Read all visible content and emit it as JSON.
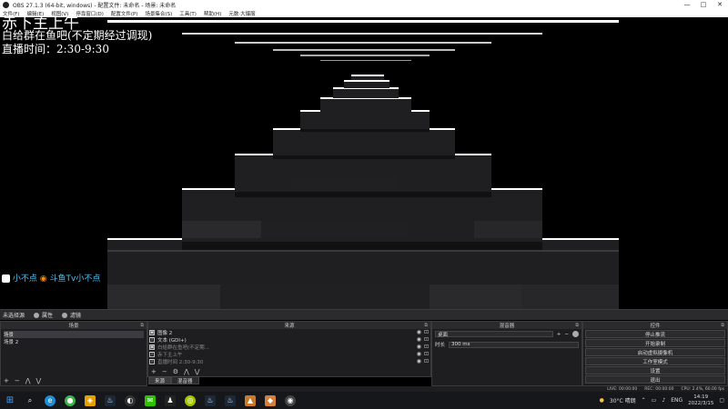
{
  "window": {
    "title": "OBS 27.1.3 (64-bit, windows) - 配置文件: 未命名 - 场景: 未命名",
    "controls": [
      "—",
      "□",
      "✕"
    ]
  },
  "menu": [
    "文件(F)",
    "编辑(E)",
    "视图(V)",
    "停靠窗口(D)",
    "配置文件(P)",
    "场景集合(S)",
    "工具(T)",
    "帮助(H)",
    "元数·大爆服"
  ],
  "overlay": {
    "line1": "赤下主上午",
    "line2": "白给群在鱼吧(不定期经过调现)",
    "line3": "直播时间：2:30-9:30"
  },
  "watermark": {
    "small": "小不点",
    "tv": "斗鱼Tv小不点"
  },
  "scene_bar": {
    "label": "未选择源",
    "props": "属性",
    "filters": "滤镜"
  },
  "scenes": {
    "title": "场景",
    "items": [
      "场景",
      "场景 2"
    ],
    "selected": 0
  },
  "sources": {
    "title": "来源",
    "items": [
      {
        "icon": "image-icon",
        "label": "图像 2"
      },
      {
        "icon": "text-icon",
        "label": "文本 (GDI+)"
      },
      {
        "icon": "image-icon",
        "label": "白给群在鱼吧(不定期..."
      },
      {
        "icon": "text-icon",
        "label": "赤下主上午"
      },
      {
        "icon": "text-icon",
        "label": "直播时间 2:30-9:30"
      }
    ],
    "tabs": [
      "来源",
      "混音器"
    ]
  },
  "mixer": {
    "title": "混音器",
    "rows": [
      {
        "label": "",
        "value": "桌面"
      },
      {
        "label": "时长",
        "value": "300 ms"
      }
    ]
  },
  "controls": {
    "title": "控件",
    "buttons": [
      "停止推流",
      "开始录制",
      "启动虚拟摄像机",
      "工作室模式",
      "设置",
      "退出"
    ]
  },
  "status": {
    "live": "LIVE: 00:00:00",
    "rec": "REC: 00:00:00",
    "cpu": "CPU: 2.4%, 60.00 fps"
  },
  "taskbar": {
    "weather": "30°C 晴朗",
    "lang": "ENG",
    "time": "14:19",
    "date": "2022/3/15"
  }
}
